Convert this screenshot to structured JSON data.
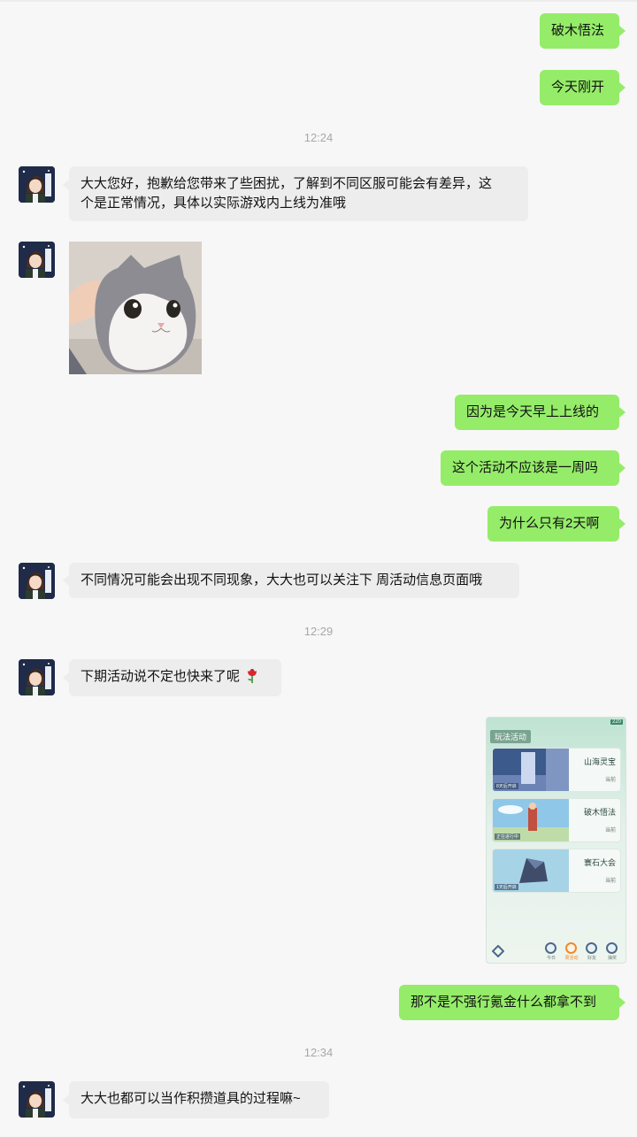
{
  "messages": {
    "m1": "破木悟法",
    "m2": "今天刚开",
    "t1": "12:24",
    "m3_line1": "大大您好，抱歉给您带来了些困扰，了解到不同区服可能会有差异，这",
    "m3_line2": "个是正常情况，具体以实际游戏内上线为准哦",
    "m5": "因为是今天早上上线的",
    "m6": "这个活动不应该是一周吗",
    "m7": "为什么只有2天啊",
    "m8": "不同情况可能会出现不同现象，大大也可以关注下 周活动信息页面哦",
    "t2": "12:29",
    "m9": "下期活动说不定也快来了呢",
    "m11": "那不是不强行氪金什么都拿不到",
    "t3": "12:34",
    "m12": "大大也都可以当作积攒道具的过程嘛~"
  },
  "screenshot": {
    "header": "玩法活动",
    "clock": "220",
    "cards": [
      {
        "title": "山海灵宝",
        "sub": "当前",
        "tag": "8天后开启"
      },
      {
        "title": "破木悟法",
        "sub": "当前",
        "tag": "正在进行中"
      },
      {
        "title": "寰石大会",
        "sub": "当前",
        "tag": "1天后开启"
      }
    ],
    "dock": [
      "今日",
      "周活动",
      "好友",
      "抽奖"
    ]
  },
  "colors": {
    "my_bubble": "#95ec69",
    "their_bubble": "#ededed",
    "background": "#f7f7f7"
  }
}
